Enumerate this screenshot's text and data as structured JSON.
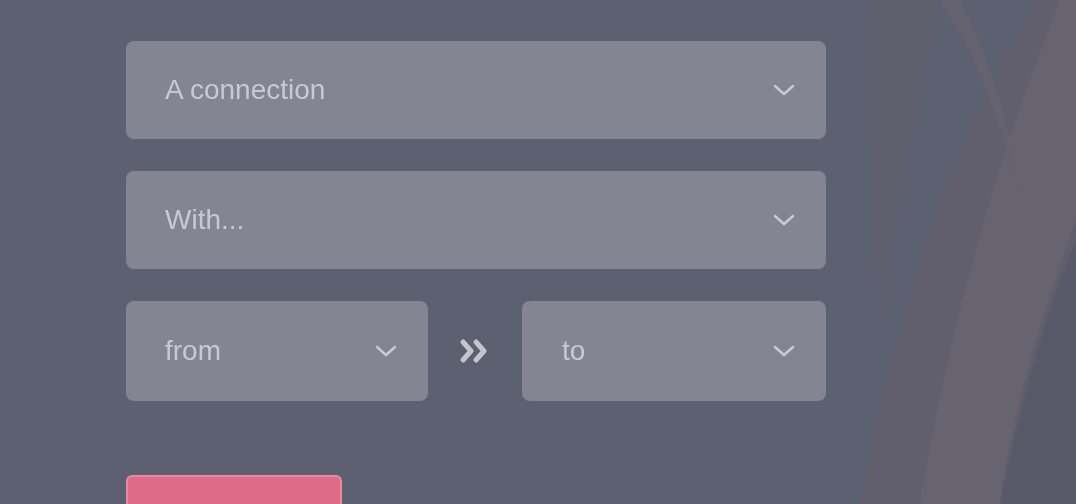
{
  "fields": [
    {
      "placeholder": "A connection"
    },
    {
      "placeholder": "With..."
    }
  ],
  "range": {
    "from": {
      "placeholder": "from"
    },
    "to": {
      "placeholder": "to"
    }
  },
  "submit_button": {
    "kind": "primary"
  }
}
